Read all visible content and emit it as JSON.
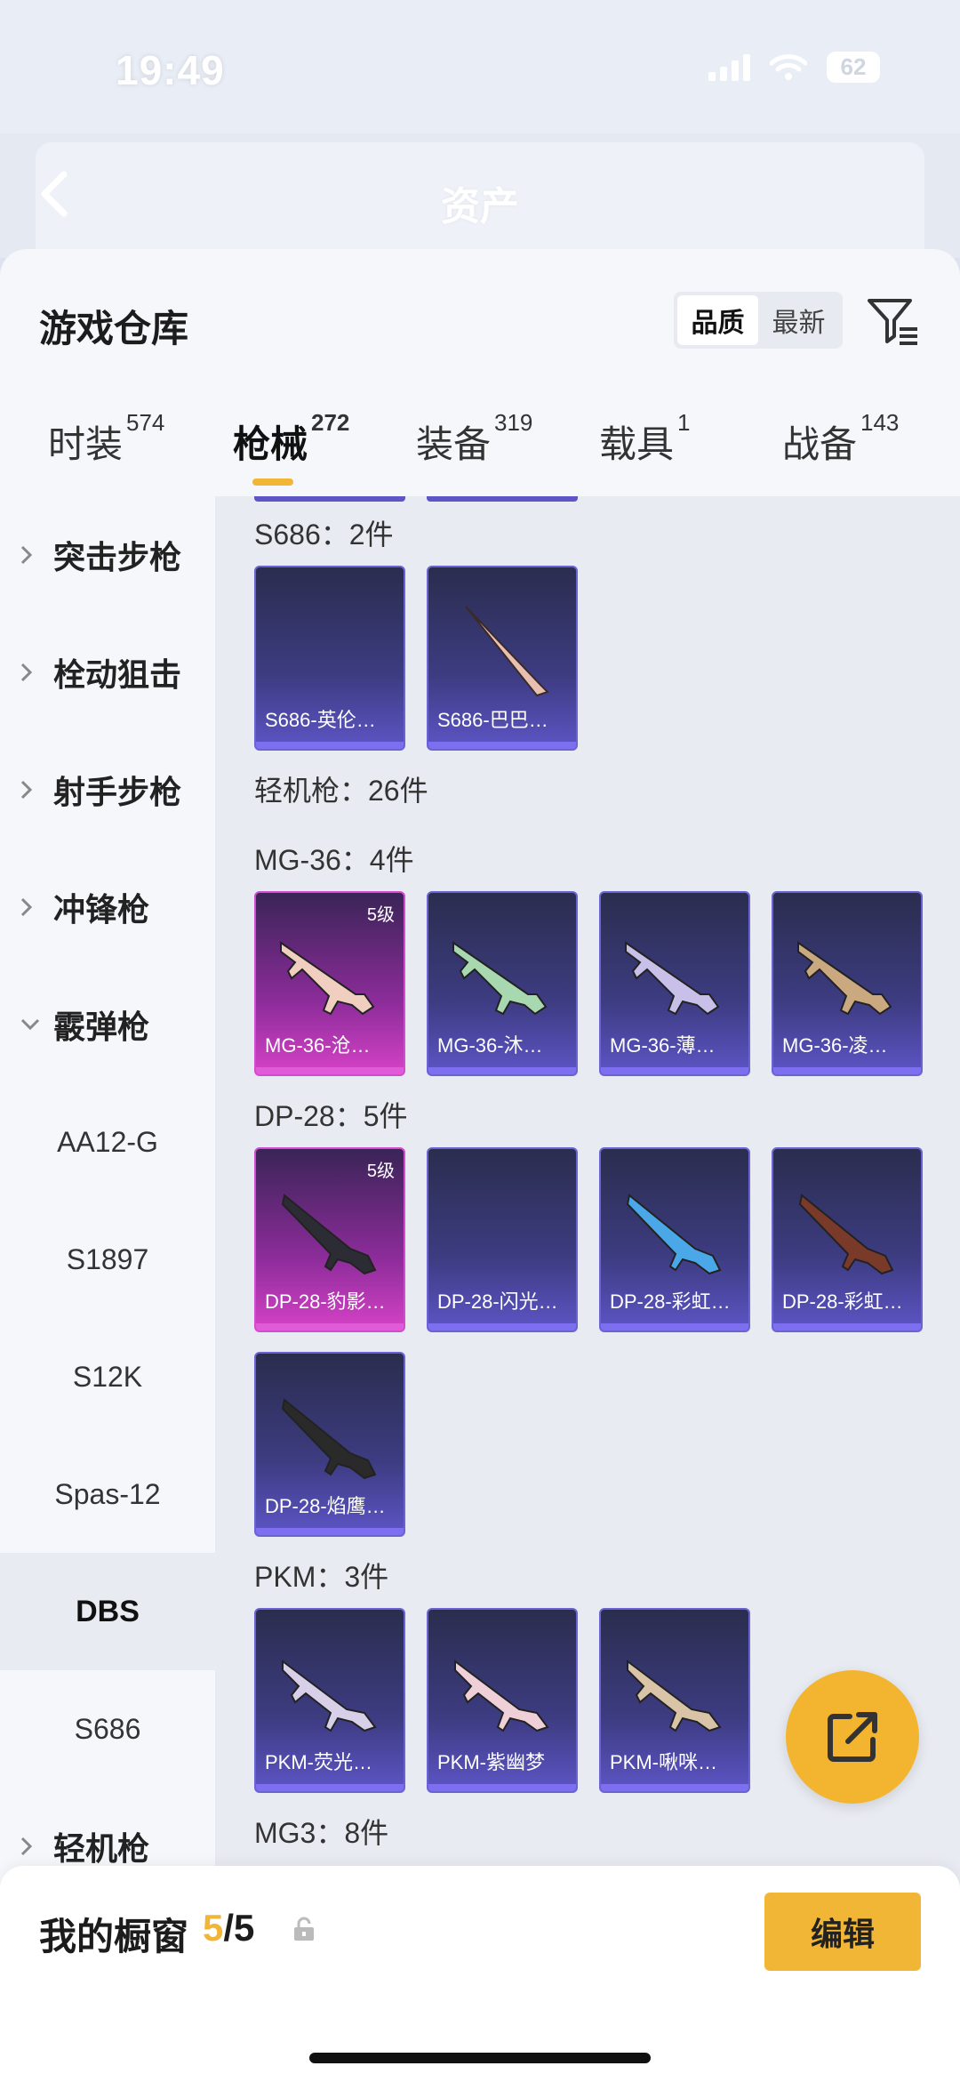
{
  "status": {
    "time": "19:49",
    "battery": "62"
  },
  "nav": {
    "title": "资产"
  },
  "header": {
    "title": "游戏仓库",
    "sort_options": [
      "品质",
      "最新"
    ],
    "active_sort": 0
  },
  "categories": [
    {
      "label": "时装",
      "count": "574"
    },
    {
      "label": "枪械",
      "count": "272"
    },
    {
      "label": "装备",
      "count": "319"
    },
    {
      "label": "载具",
      "count": "1"
    },
    {
      "label": "战备",
      "count": "143"
    }
  ],
  "active_category": 1,
  "sidebar": {
    "items": [
      {
        "label": "突击步枪",
        "type": "collapsed"
      },
      {
        "label": "栓动狙击",
        "type": "collapsed"
      },
      {
        "label": "射手步枪",
        "type": "collapsed"
      },
      {
        "label": "冲锋枪",
        "type": "collapsed"
      },
      {
        "label": "霰弹枪",
        "type": "expanded"
      },
      {
        "label": "AA12-G",
        "type": "sub"
      },
      {
        "label": "S1897",
        "type": "sub"
      },
      {
        "label": "S12K",
        "type": "sub"
      },
      {
        "label": "Spas-12",
        "type": "sub"
      },
      {
        "label": "DBS",
        "type": "selected"
      },
      {
        "label": "S686",
        "type": "sub"
      },
      {
        "label": "轻机枪",
        "type": "collapsed"
      }
    ]
  },
  "groups": [
    {
      "label": "S686：2件",
      "items": [
        {
          "name": "S686-英伦…",
          "level": "",
          "tier": "purple",
          "gun": "none"
        },
        {
          "name": "S686-巴巴…",
          "level": "",
          "tier": "purple",
          "gun": "shotgun"
        }
      ]
    },
    {
      "label": "轻机枪：26件",
      "items": []
    },
    {
      "label": "MG-36：4件",
      "items": [
        {
          "name": "MG-36-沧…",
          "level": "5级",
          "tier": "pink",
          "gun": "lmg"
        },
        {
          "name": "MG-36-沐…",
          "level": "",
          "tier": "purple",
          "gun": "lmg"
        },
        {
          "name": "MG-36-薄…",
          "level": "",
          "tier": "purple",
          "gun": "lmg"
        },
        {
          "name": "MG-36-凌…",
          "level": "",
          "tier": "purple",
          "gun": "lmg"
        }
      ]
    },
    {
      "label": "DP-28：5件",
      "items": [
        {
          "name": "DP-28-豹影…",
          "level": "5级",
          "tier": "pink",
          "gun": "dp"
        },
        {
          "name": "DP-28-闪光…",
          "level": "",
          "tier": "purple",
          "gun": "none"
        },
        {
          "name": "DP-28-彩虹…",
          "level": "",
          "tier": "purple",
          "gun": "dp"
        },
        {
          "name": "DP-28-彩虹…",
          "level": "",
          "tier": "purple",
          "gun": "dp"
        },
        {
          "name": "DP-28-焰鹰…",
          "level": "",
          "tier": "purple",
          "gun": "dp"
        }
      ]
    },
    {
      "label": "PKM：3件",
      "items": [
        {
          "name": "PKM-荧光…",
          "level": "",
          "tier": "purple",
          "gun": "pkm"
        },
        {
          "name": "PKM-紫幽梦",
          "level": "",
          "tier": "purple",
          "gun": "pkm"
        },
        {
          "name": "PKM-啾咪…",
          "level": "",
          "tier": "purple",
          "gun": "pkm"
        }
      ]
    },
    {
      "label": "MG3：8件",
      "items": []
    }
  ],
  "gun_colors": [
    "#d9c4a8",
    "#e8c0b0",
    "#f0cfc0",
    "#a8d8b0",
    "#c8c0e8",
    "#caa880",
    "#2c2c34",
    "#e8e0d8",
    "#4aa8e8",
    "#7a3a2a",
    "#2a2a2a",
    "#d8d0e8",
    "#f0d0d8"
  ],
  "showcase": {
    "label": "我的橱窗",
    "current": "5",
    "total": "/5",
    "edit_label": "编辑"
  },
  "icons": {
    "back": "chevron-left-icon",
    "filter": "filter-icon",
    "share": "share-icon",
    "lock": "lock-icon"
  }
}
